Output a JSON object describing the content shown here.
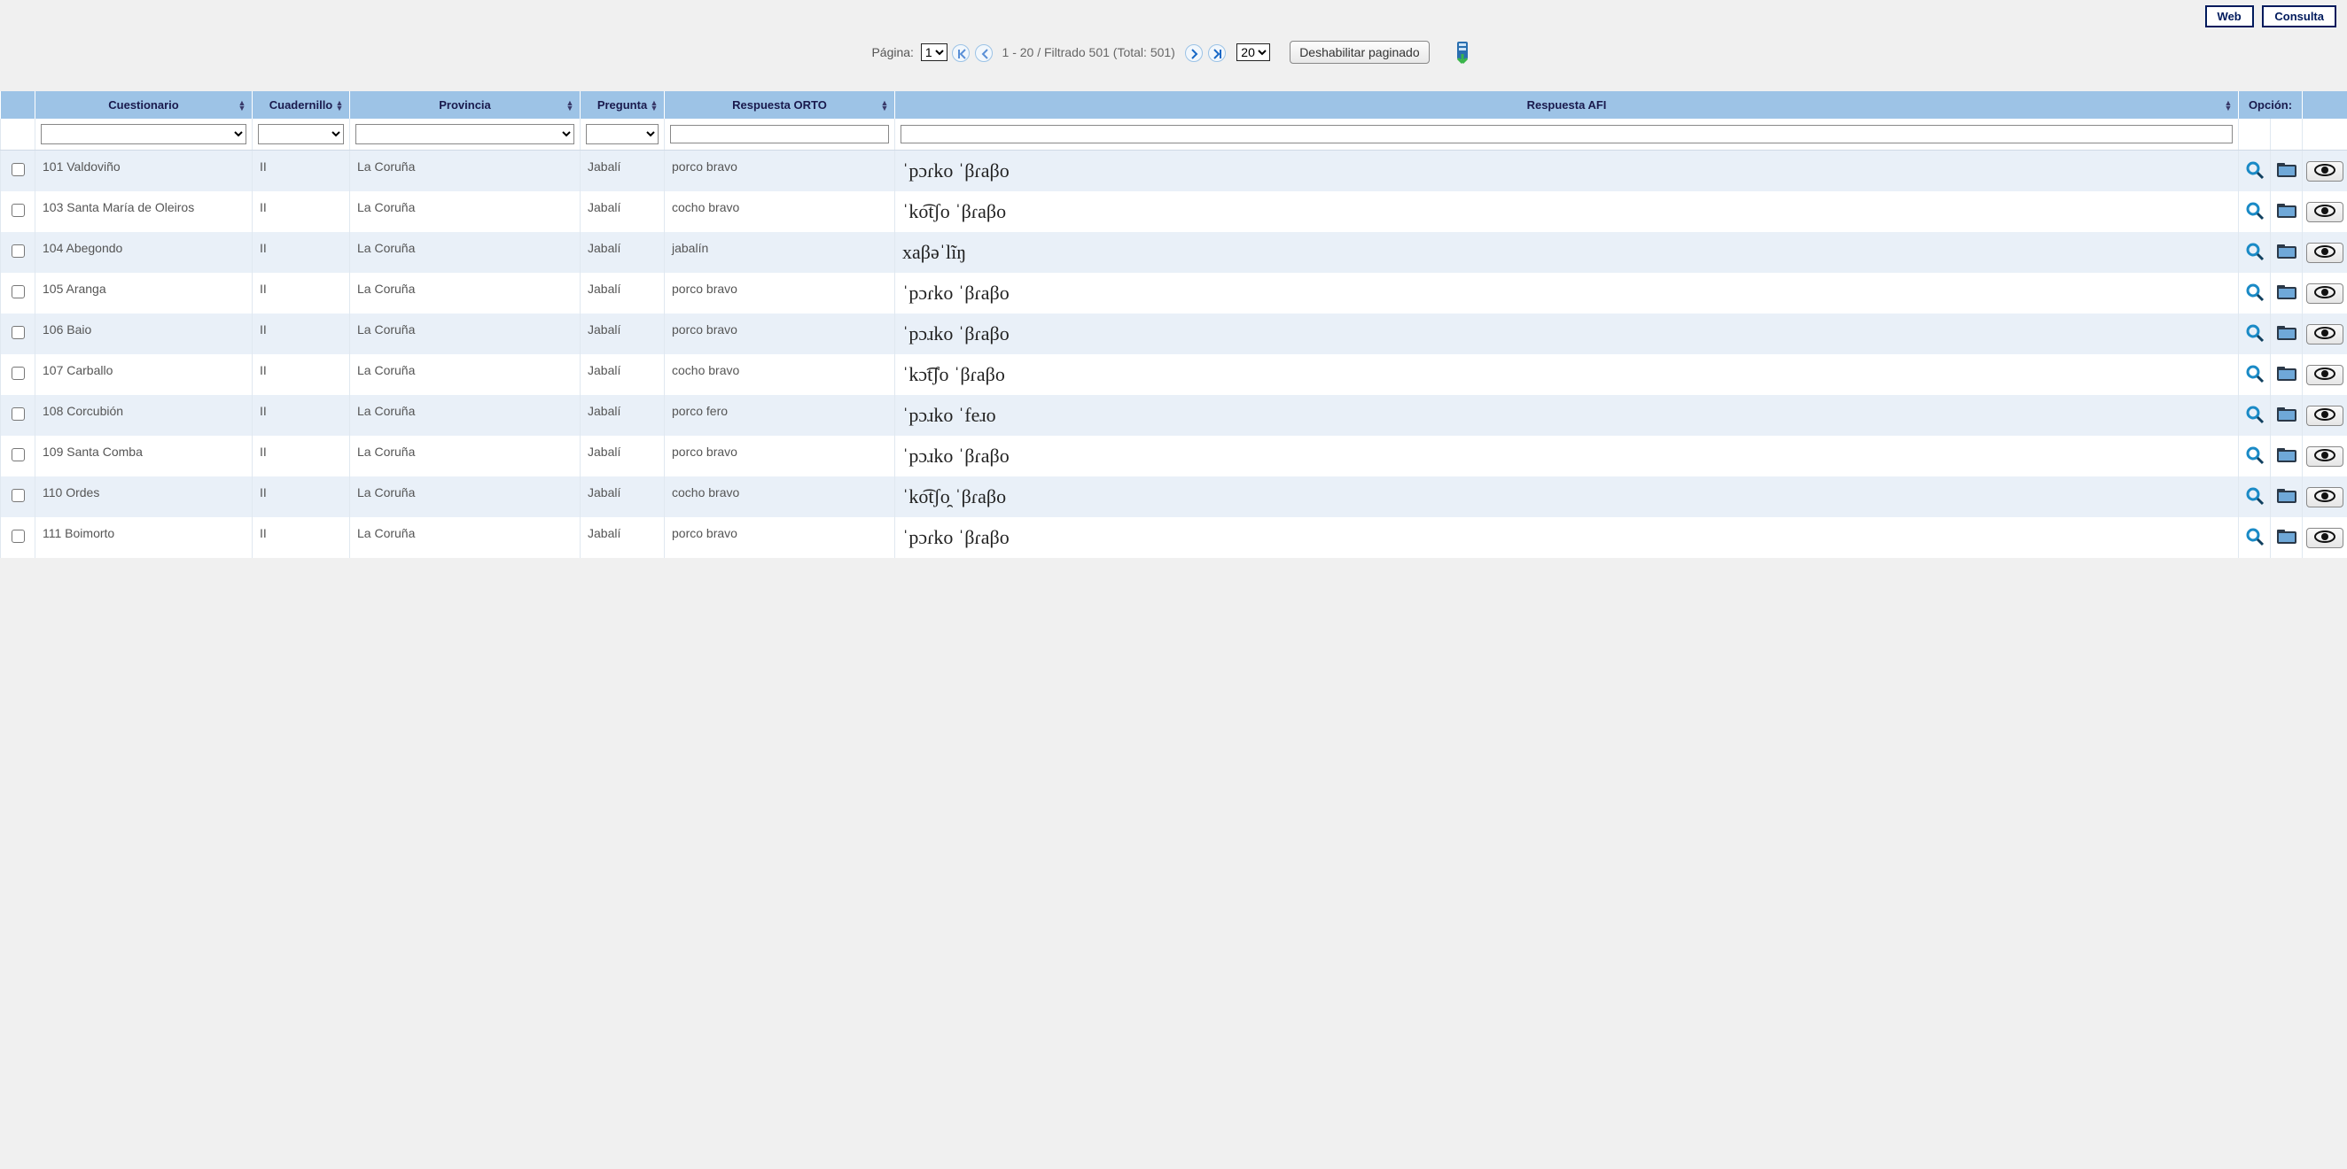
{
  "topnav": {
    "web": "Web",
    "consulta": "Consulta"
  },
  "pager": {
    "label": "Página:",
    "page_select_value": "1",
    "range_text": "1 - 20 / Filtrado 501 (Total: 501)",
    "size_select_value": "20",
    "disable_pagination_label": "Deshabilitar paginado"
  },
  "columns": {
    "cuestionario": "Cuestionario",
    "cuadernillo": "Cuadernillo",
    "provincia": "Provincia",
    "pregunta": "Pregunta",
    "respuesta_orto": "Respuesta ORTO",
    "respuesta_afi": "Respuesta AFI",
    "opcion": "Opción:"
  },
  "rows": [
    {
      "cuestionario": "101 Valdoviño",
      "cuadernillo": "II",
      "provincia": "La Coruña",
      "pregunta": "Jabalí",
      "orto": "porco bravo",
      "afi": "ˈpɔɾko ˈβɾaβo"
    },
    {
      "cuestionario": "103 Santa María de Oleiros",
      "cuadernillo": "II",
      "provincia": "La Coruña",
      "pregunta": "Jabalí",
      "orto": "cocho bravo",
      "afi": "ˈko͡tʃo ˈβɾaβo"
    },
    {
      "cuestionario": "104 Abegondo",
      "cuadernillo": "II",
      "provincia": "La Coruña",
      "pregunta": "Jabalí",
      "orto": "jabalín",
      "afi": "xaβəˈlĩŋ"
    },
    {
      "cuestionario": "105 Aranga",
      "cuadernillo": "II",
      "provincia": "La Coruña",
      "pregunta": "Jabalí",
      "orto": "porco bravo",
      "afi": "ˈpɔɾko ˈβɾaβo"
    },
    {
      "cuestionario": "106 Baio",
      "cuadernillo": "II",
      "provincia": "La Coruña",
      "pregunta": "Jabalí",
      "orto": "porco bravo",
      "afi": "ˈpɔɹko ˈβɾaβo"
    },
    {
      "cuestionario": "107 Carballo",
      "cuadernillo": "II",
      "provincia": "La Coruña",
      "pregunta": "Jabalí",
      "orto": "cocho bravo",
      "afi": "ˈkɔ͡tʃo ˈβɾaβo"
    },
    {
      "cuestionario": "108 Corcubión",
      "cuadernillo": "II",
      "provincia": "La Coruña",
      "pregunta": "Jabalí",
      "orto": "porco fero",
      "afi": "ˈpɔɹko ˈfeɹo"
    },
    {
      "cuestionario": "109 Santa Comba",
      "cuadernillo": "II",
      "provincia": "La Coruña",
      "pregunta": "Jabalí",
      "orto": "porco bravo",
      "afi": "ˈpɔɹko ˈβɾaβo"
    },
    {
      "cuestionario": "110 Ordes",
      "cuadernillo": "II",
      "provincia": "La Coruña",
      "pregunta": "Jabalí",
      "orto": "cocho bravo",
      "afi": "ˈko͡tʃo̯ ˈβɾaβo"
    },
    {
      "cuestionario": "111 Boimorto",
      "cuadernillo": "II",
      "provincia": "La Coruña",
      "pregunta": "Jabalí",
      "orto": "porco bravo",
      "afi": "ˈpɔɾko ˈβɾaβo"
    }
  ]
}
